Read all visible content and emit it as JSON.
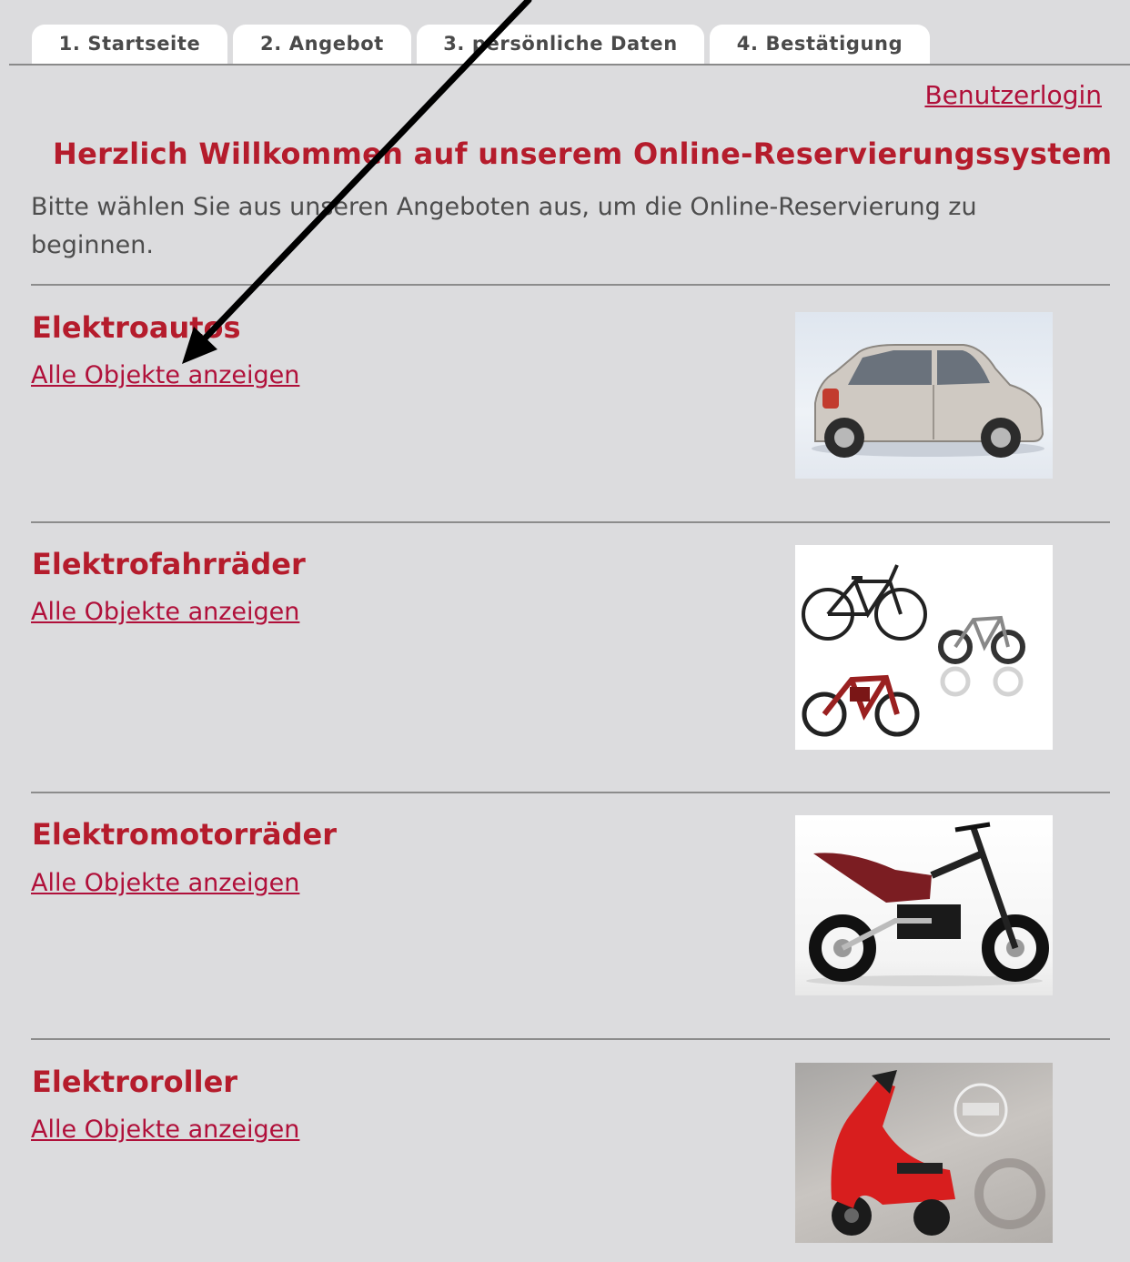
{
  "tabs": [
    {
      "label": "1. Startseite"
    },
    {
      "label": "2. Angebot"
    },
    {
      "label": "3. persönliche Daten"
    },
    {
      "label": "4. Bestätigung"
    }
  ],
  "login_link": "Benutzerlogin",
  "welcome_title": "Herzlich Willkommen auf unserem Online-Reservierungssystem",
  "intro_text": "Bitte wählen Sie aus unseren Angeboten aus, um die Online-Reservierung zu beginnen.",
  "categories": [
    {
      "title": "Elektroautos",
      "link": "Alle Objekte anzeigen",
      "image_icon": "car-photo"
    },
    {
      "title": "Elektrofahrräder",
      "link": "Alle Objekte anzeigen",
      "image_icon": "ebikes-photo"
    },
    {
      "title": "Elektromotorräder",
      "link": "Alle Objekte anzeigen",
      "image_icon": "motorbike-photo"
    },
    {
      "title": "Elektroroller",
      "link": "Alle Objekte anzeigen",
      "image_icon": "scooter-photo"
    }
  ],
  "colors": {
    "accent": "#b51c2c",
    "link": "#b0103a",
    "background": "#dcdcde"
  }
}
